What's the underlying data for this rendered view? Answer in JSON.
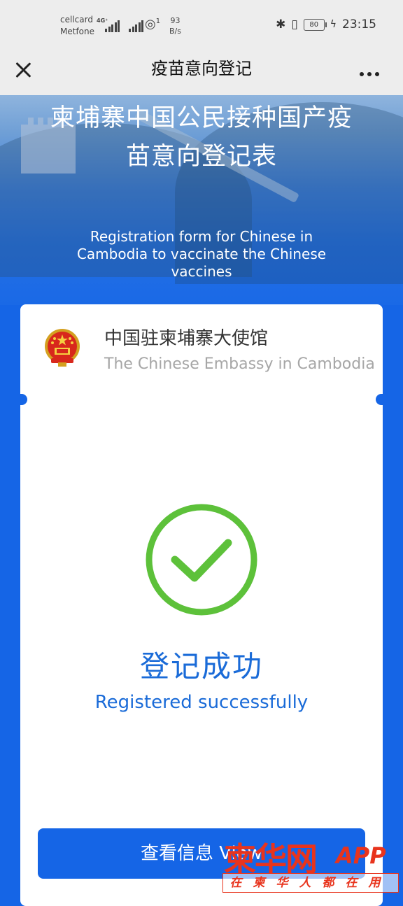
{
  "status_bar": {
    "carrier1": "cellcard",
    "carrier2": "Metfone",
    "network_tag": "4G⁺",
    "hotspot_count": "1",
    "speed_value": "93",
    "speed_unit": "B/s",
    "battery": "80",
    "time": "23:15"
  },
  "navbar": {
    "title": "疫苗意向登记",
    "close_icon": "close-icon",
    "more_icon": "more-icon"
  },
  "hero": {
    "title": "柬埔寨中国公民接种国产疫苗意向登记表",
    "subtitle": "Registration form for Chinese in Cambodia to vaccinate the Chinese vaccines"
  },
  "card": {
    "org_cn": "中国驻柬埔寨大使馆",
    "org_en": "The Chinese Embassy in Cambodia",
    "success_cn": "登记成功",
    "success_en": "Registered successfully",
    "view_button": "查看信息 View"
  },
  "watermark": {
    "logo": "柬华网",
    "app": "APP",
    "slogan": "在柬华人都在用"
  },
  "colors": {
    "primary": "#1565e6",
    "success": "#5dc13a",
    "success_text": "#1a6bd8",
    "watermark": "#e8341d"
  }
}
